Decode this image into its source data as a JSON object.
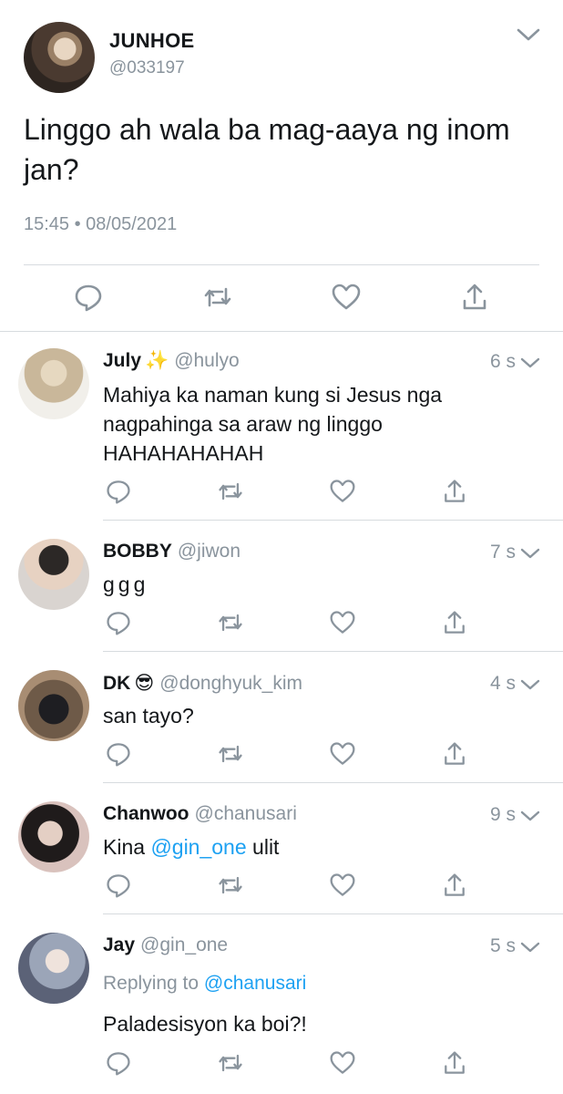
{
  "main": {
    "name": "JUNHOE",
    "handle": "@033197",
    "text": "Linggo ah wala ba mag-aaya ng inom jan?",
    "meta": "15:45 • 08/05/2021"
  },
  "replies": [
    {
      "name": "July",
      "emoji": "✨",
      "handle": "@hulyo",
      "time": "6 s",
      "text": "Mahiya ka naman kung si Jesus nga nagpahinga sa araw ng linggo HAHAHAHAHAH"
    },
    {
      "name": "BOBBY",
      "handle": "@jiwon",
      "time": "7 s",
      "text": "ggg"
    },
    {
      "name": "DK",
      "emoji": "😎",
      "handle": "@donghyuk_kim",
      "time": "4 s",
      "text": "san tayo?"
    },
    {
      "name": "Chanwoo",
      "handle": "@chanusari",
      "time": "9 s",
      "text_before": "Kina ",
      "mention": "@gin_one",
      "text_after": " ulit"
    },
    {
      "name": "Jay",
      "handle": "@gin_one",
      "time": "5 s",
      "replying_prefix": "Replying to ",
      "replying_to": "@chanusari",
      "text": "Paladesisyon ka boi?!"
    }
  ],
  "icons": {
    "reply": "reply-icon",
    "retweet": "retweet-icon",
    "like": "heart-icon",
    "share": "share-icon",
    "menu": "chevron-down-icon"
  },
  "colors": {
    "text": "#14171a",
    "secondary": "#8a949d",
    "link": "#1da1f2",
    "divider": "#d7dbdf"
  }
}
